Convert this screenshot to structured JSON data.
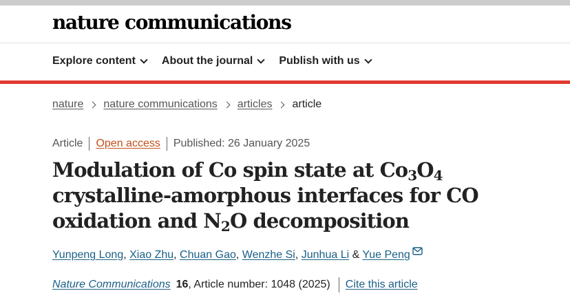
{
  "header": {
    "brand": "nature communications",
    "nav": [
      {
        "label": "Explore content"
      },
      {
        "label": "About the journal"
      },
      {
        "label": "Publish with us"
      }
    ]
  },
  "colors": {
    "accent_bar": "#e03a30",
    "link": "#1a5f86",
    "open_access": "#c24e19"
  },
  "breadcrumb": {
    "items": [
      "nature",
      "nature communications",
      "articles"
    ],
    "current": "article"
  },
  "article": {
    "type": "Article",
    "access": "Open access",
    "published": "Published: 26 January 2025",
    "title": {
      "part1": "Modulation of Co spin state at Co",
      "sub1": "3",
      "part2": "O",
      "sub2": "4",
      "part3": " crystalline-amorphous interfaces for CO oxidation and N",
      "sub3": "2",
      "part4": "O decomposition"
    },
    "authors": [
      "Yunpeng Long",
      "Xiao Zhu",
      "Chuan Gao",
      "Wenzhe Si",
      "Junhua Li",
      "Yue Peng"
    ],
    "author_sep": ", ",
    "author_amp": " & ",
    "corresponding_icon": "mail-icon",
    "journal": "Nature Communications",
    "volume": "16",
    "article_number": ", Article number: 1048 (2025)",
    "cite_label": "Cite this article"
  }
}
